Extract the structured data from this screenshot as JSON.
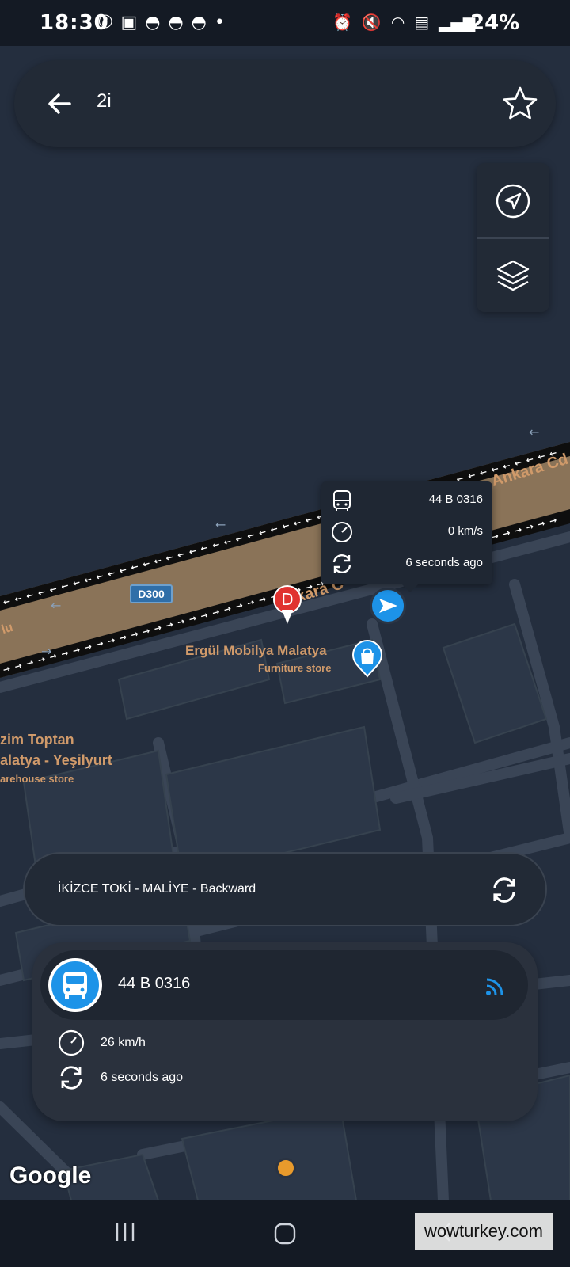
{
  "status_bar": {
    "time": "18:30",
    "notification_icons": [
      "whatsapp-icon",
      "facebook-icon",
      "discord-icon",
      "discord-icon",
      "discord-icon",
      "dot-icon"
    ],
    "system_icons": [
      "alarm-icon",
      "mute-icon",
      "wifi-icon",
      "volte-icon",
      "signal-icon"
    ],
    "battery": "24%"
  },
  "search": {
    "query": "2i"
  },
  "map": {
    "road_labels": [
      "Ankara Cd",
      "Ankara C",
      "lu"
    ],
    "road_shield": "D300",
    "destination_marker": "D",
    "pois": {
      "ergul_name": "Ergül Mobilya Malatya",
      "ergul_type": "Furniture store",
      "toptan_line1": "zim Toptan",
      "toptan_line2": "alatya - Yeşilyurt",
      "toptan_line3": "arehouse store"
    },
    "popup": {
      "plate": "44 B 0316",
      "speed": "0 km/s",
      "updated": "6 seconds ago"
    }
  },
  "route": {
    "label": "İKİZCE TOKİ - MALİYE  - Backward"
  },
  "vehicle_card": {
    "plate": "44 B 0316",
    "speed": "26 km/h",
    "updated": "6 seconds ago"
  },
  "map_attribution": "Google",
  "watermark": "wowturkey.com",
  "colors": {
    "map_bg": "#242e3e",
    "accent_blue": "#1d93e8",
    "poi_text": "#d09a6a",
    "marker_red": "#e0322f",
    "road_fill": "#8a7358"
  }
}
